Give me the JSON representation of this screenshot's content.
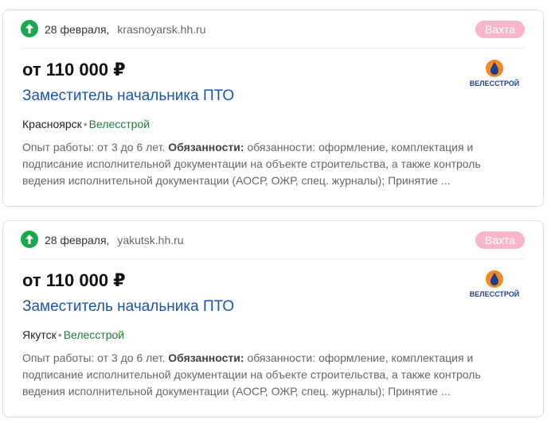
{
  "cards": [
    {
      "date": "28 февраля",
      "source": "krasnoyarsk.hh.ru",
      "badge": "Вахта",
      "salary": "от 110 000 ₽",
      "title": "Заместитель начальника ПТО",
      "city": "Красноярск",
      "company": "Велесстрой",
      "logo_text": "ВЕЛЕССТРОЙ",
      "desc_prefix": "Опыт работы: от 3 до 6 лет.",
      "desc_bold": "Обязанности:",
      "desc_text": "обязанности: оформление, комплектация и подписание исполнительной документации на объекте строительства, а также контроль ведения исполнительной документации (АОСР, ОЖР, спец. журналы); Принятие ..."
    },
    {
      "date": "28 февраля",
      "source": "yakutsk.hh.ru",
      "badge": "Вахта",
      "salary": "от 110 000 ₽",
      "title": "Заместитель начальника ПТО",
      "city": "Якутск",
      "company": "Велесстрой",
      "logo_text": "ВЕЛЕССТРОЙ",
      "desc_prefix": "Опыт работы: от 3 до 6 лет.",
      "desc_bold": "Обязанности:",
      "desc_text": "обязанности: оформление, комплектация и подписание исполнительной документации на объекте строительства, а также контроль ведения исполнительной документации (АОСР, ОЖР, спец. журналы); Принятие ..."
    }
  ],
  "colors": {
    "up_icon": "#1aa84f",
    "badge_bg": "#f7b7c7",
    "title_link": "#1a55b3",
    "company": "#1f7a3d",
    "logo_orange": "#f08a24",
    "logo_blue": "#1d3f8f"
  },
  "icons": {
    "boost": "arrow-up-circle-icon",
    "logo": "velesstroy-logo"
  }
}
